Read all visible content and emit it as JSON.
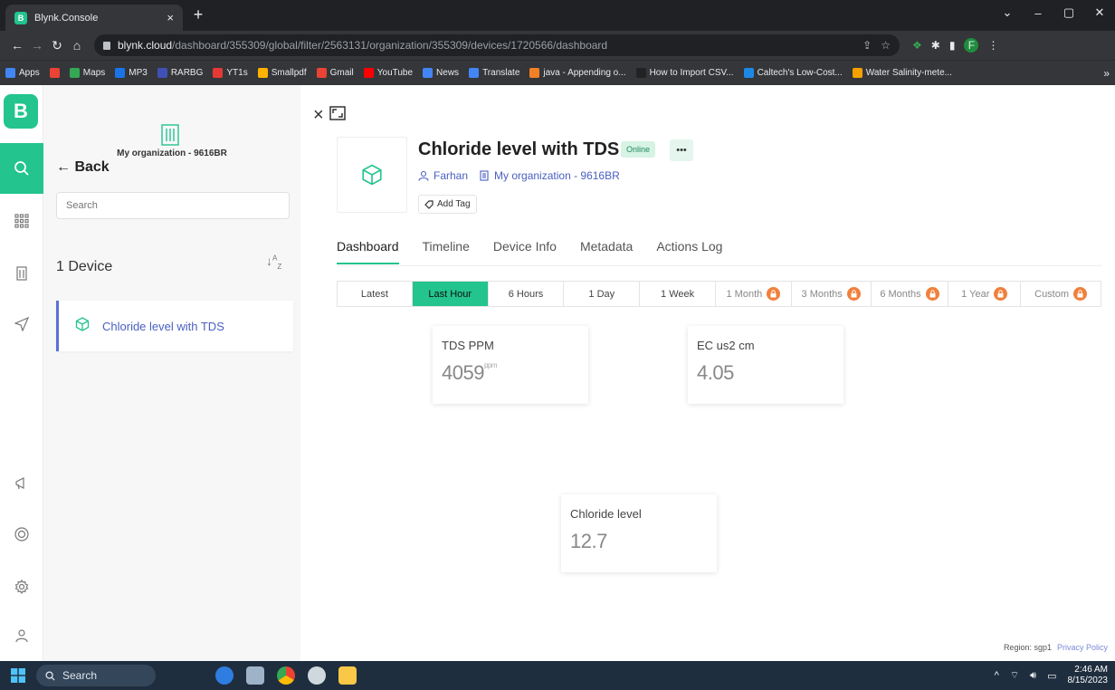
{
  "browser": {
    "tab_title": "Blynk.Console",
    "favicon_letter": "B",
    "url_host": "blynk.cloud",
    "url_path": "/dashboard/355309/global/filter/2563131/organization/355309/devices/1720566/dashboard",
    "profile_letter": "F",
    "bookmarks": [
      {
        "label": "Apps",
        "color": "#4285f4"
      },
      {
        "label": "",
        "color": "#ea4335"
      },
      {
        "label": "Maps",
        "color": "#34a853"
      },
      {
        "label": "MP3",
        "color": "#1a73e8"
      },
      {
        "label": "RARBG",
        "color": "#3f51b5"
      },
      {
        "label": "YT1s",
        "color": "#e53935"
      },
      {
        "label": "Smallpdf",
        "color": "#ffb300"
      },
      {
        "label": "Gmail",
        "color": "#ea4335"
      },
      {
        "label": "YouTube",
        "color": "#ff0000"
      },
      {
        "label": "News",
        "color": "#4285f4"
      },
      {
        "label": "Translate",
        "color": "#4285f4"
      },
      {
        "label": "java - Appending o...",
        "color": "#f48024"
      },
      {
        "label": "How to Import CSV...",
        "color": "#222222"
      },
      {
        "label": "Caltech's Low-Cost...",
        "color": "#1e88e5"
      },
      {
        "label": "Water Salinity-mete...",
        "color": "#f4a100"
      }
    ]
  },
  "panel": {
    "org_name": "My organization - 9616BR",
    "back_label": "Back",
    "search_placeholder": "Search",
    "device_count": "1 Device",
    "devices": [
      {
        "name": "Chloride level with TDS"
      }
    ]
  },
  "device": {
    "title": "Chloride level with TDS",
    "status": "Online",
    "more": "•••",
    "owner": "Farhan",
    "organization": "My organization - 9616BR",
    "add_tag": "Add Tag"
  },
  "tabs": [
    "Dashboard",
    "Timeline",
    "Device Info",
    "Metadata",
    "Actions Log"
  ],
  "active_tab": "Dashboard",
  "time_ranges": [
    {
      "label": "Latest",
      "locked": false,
      "active": false
    },
    {
      "label": "Last Hour",
      "locked": false,
      "active": true
    },
    {
      "label": "6 Hours",
      "locked": false,
      "active": false
    },
    {
      "label": "1 Day",
      "locked": false,
      "active": false
    },
    {
      "label": "1 Week",
      "locked": false,
      "active": false
    },
    {
      "label": "1 Month",
      "locked": true,
      "active": false
    },
    {
      "label": "3 Months",
      "locked": true,
      "active": false
    },
    {
      "label": "6 Months",
      "locked": true,
      "active": false
    },
    {
      "label": "1 Year",
      "locked": true,
      "active": false
    },
    {
      "label": "Custom",
      "locked": true,
      "active": false
    }
  ],
  "widgets": {
    "tds": {
      "label": "TDS PPM",
      "value": "4059",
      "unit": "ppm"
    },
    "ec": {
      "label": "EC us2 cm",
      "value": "4.05"
    },
    "chloride": {
      "label": "Chloride level",
      "value": "12.7"
    }
  },
  "footer": {
    "region": "Region: sgp1",
    "privacy": "Privacy Policy"
  },
  "taskbar": {
    "search_label": "Search",
    "time": "2:46 AM",
    "date": "8/15/2023"
  },
  "colors": {
    "brand": "#23c48e",
    "link": "#4a5fc1",
    "lock_badge": "#f0803c"
  }
}
